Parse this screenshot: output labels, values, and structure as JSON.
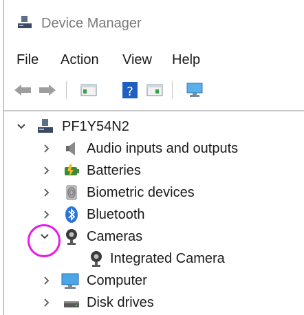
{
  "window": {
    "title": "Device Manager"
  },
  "menubar": {
    "file": "File",
    "action": "Action",
    "view": "View",
    "help": "Help"
  },
  "toolbar": {
    "buttons": [
      "back-icon",
      "forward-icon",
      "properties-icon",
      "help-icon",
      "update-driver-icon",
      "scan-hardware-icon"
    ]
  },
  "tree": {
    "root": {
      "label": "PF1Y54N2",
      "expanded": true
    },
    "items": [
      {
        "label": "Audio inputs and outputs",
        "expanded": false
      },
      {
        "label": "Batteries",
        "expanded": false
      },
      {
        "label": "Biometric devices",
        "expanded": false
      },
      {
        "label": "Bluetooth",
        "expanded": false
      },
      {
        "label": "Cameras",
        "expanded": true
      },
      {
        "label": "Integrated Camera"
      },
      {
        "label": "Computer",
        "expanded": false
      },
      {
        "label": "Disk drives",
        "expanded": false
      }
    ]
  },
  "colors": {
    "annotation": "#e81ce8",
    "accent": "#2a74d8"
  }
}
